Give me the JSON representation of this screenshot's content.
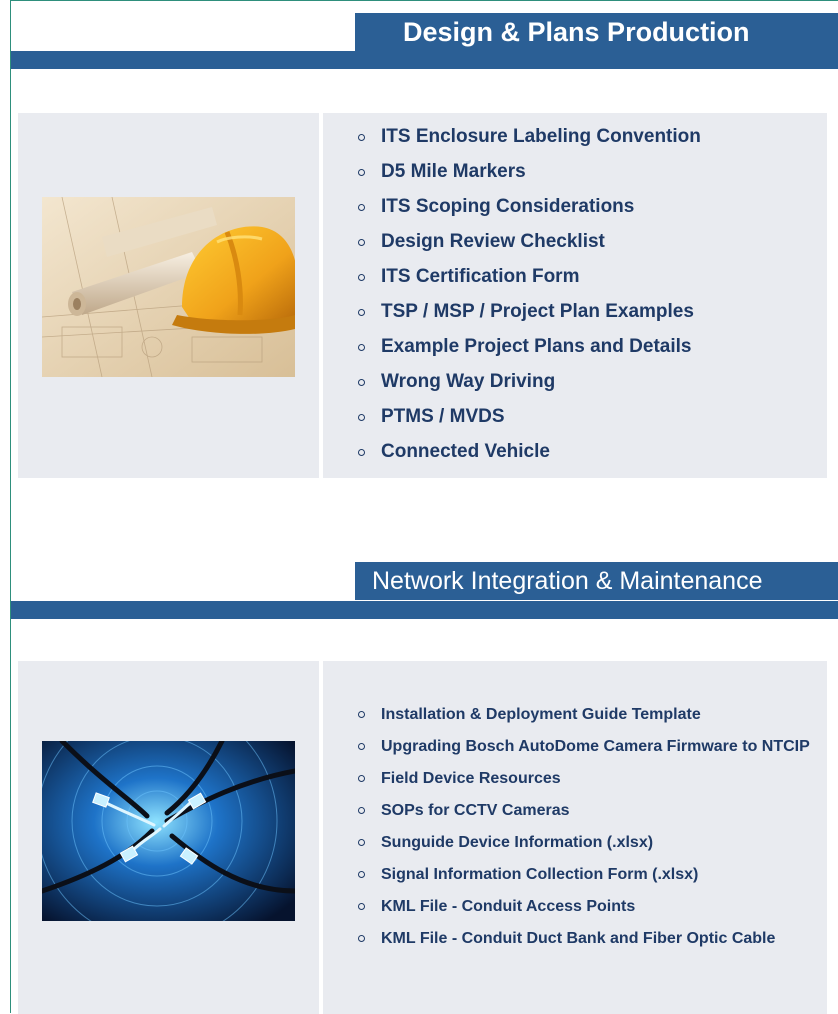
{
  "sections": [
    {
      "title": "Design & Plans Production",
      "image": "hard-hat-and-blueprints-photo",
      "links": [
        "ITS Enclosure Labeling Convention",
        "D5 Mile Markers",
        "ITS Scoping Considerations",
        "Design Review Checklist",
        "ITS Certification Form",
        "TSP / MSP / Project Plan Examples",
        "Example Project Plans and Details",
        "Wrong Way Driving",
        "PTMS / MVDS",
        "Connected Vehicle"
      ]
    },
    {
      "title": "Network Integration & Maintenance",
      "image": "network-cables-photo",
      "links": [
        "Installation & Deployment Guide Template",
        "Upgrading Bosch AutoDome Camera Firmware to NTCIP",
        "Field Device Resources",
        "SOPs for CCTV Cameras",
        "Sunguide Device Information (.xlsx)",
        "Signal Information Collection Form (.xlsx)",
        "KML File - Conduit Access Points",
        "KML File - Conduit Duct Bank and Fiber Optic Cable"
      ]
    }
  ],
  "colors": {
    "header": "#2b5f95",
    "panel": "#e9ebf0",
    "link": "#1f3a66",
    "border": "#2e8f7c"
  }
}
